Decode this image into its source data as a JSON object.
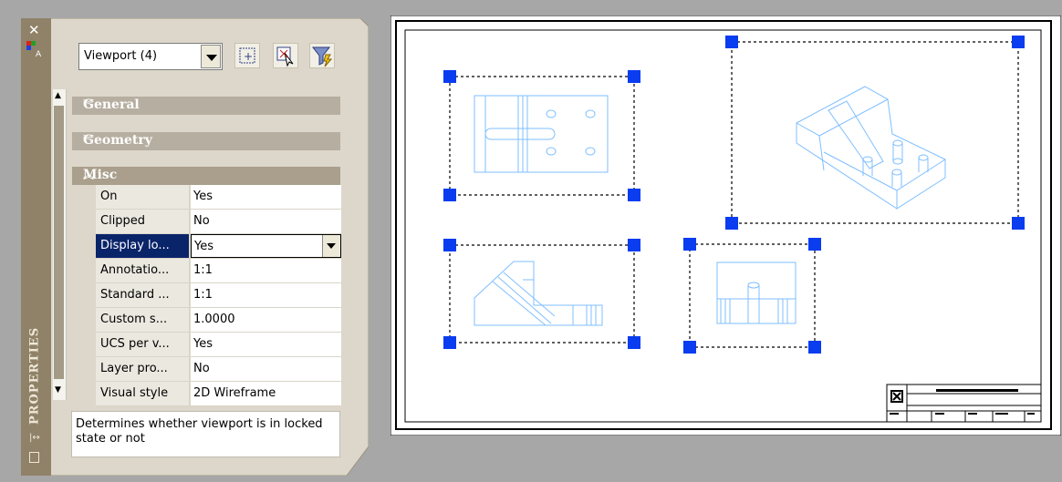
{
  "palette": {
    "title": "PROPERTIES",
    "selection": "Viewport (4)",
    "sections": {
      "general": "General",
      "geometry": "Geometry",
      "misc": "Misc"
    },
    "rows": [
      {
        "key": "On",
        "value": "Yes"
      },
      {
        "key": "Clipped",
        "value": "No"
      },
      {
        "key": "Display lo...",
        "value": "Yes"
      },
      {
        "key": "Annotatio...",
        "value": "1:1"
      },
      {
        "key": "Standard ...",
        "value": "1:1"
      },
      {
        "key": "Custom s...",
        "value": "1.0000"
      },
      {
        "key": "UCS per v...",
        "value": "Yes"
      },
      {
        "key": "Layer pro...",
        "value": "No"
      },
      {
        "key": "Visual style",
        "value": "2D Wireframe"
      }
    ],
    "description": "Determines whether viewport is in locked state or not"
  },
  "colors": {
    "grip": "#0a3cf0",
    "drawing": "#7fbfff",
    "paper": "#ffffff",
    "background": "#a7a7a7"
  },
  "icons": [
    "close-icon",
    "properties-icon",
    "select-objects-icon",
    "quick-select-icon",
    "toggle-pickadd-icon",
    "autohide-icon",
    "menu-icon"
  ]
}
